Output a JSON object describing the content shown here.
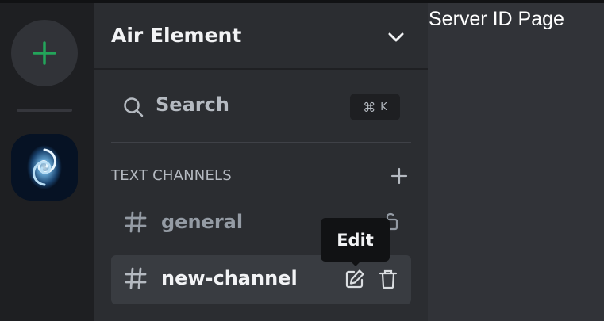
{
  "colors": {
    "background": "#313338",
    "rail": "#1e1f22",
    "sidebar": "#2b2d31",
    "accent_green": "#23a55a",
    "text_primary": "#f2f3f5",
    "text_muted": "#b5bac1"
  },
  "rail": {
    "add_server_icon": "plus-icon",
    "server_icon": "galaxy-server-icon"
  },
  "sidebar": {
    "server_name": "Air Element",
    "search": {
      "label": "Search",
      "shortcut_symbol": "⌘",
      "shortcut_key": "K"
    },
    "section": {
      "label": "TEXT CHANNELS"
    },
    "channels": [
      {
        "name": "general",
        "icon": "hash-icon",
        "action_icon": "lock-icon"
      },
      {
        "name": "new-channel",
        "icon": "hash-icon",
        "action_icons": [
          "edit-icon",
          "trash-icon"
        ]
      }
    ]
  },
  "tooltip": {
    "text": "Edit"
  },
  "main": {
    "title": "Server ID Page"
  }
}
